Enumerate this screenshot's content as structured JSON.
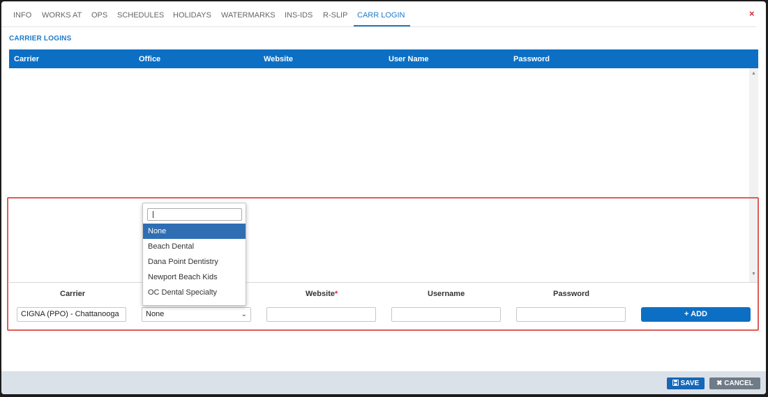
{
  "tabs": [
    {
      "label": "INFO"
    },
    {
      "label": "WORKS AT"
    },
    {
      "label": "OPS"
    },
    {
      "label": "SCHEDULES"
    },
    {
      "label": "HOLIDAYS"
    },
    {
      "label": "WATERMARKS"
    },
    {
      "label": "INS-IDS"
    },
    {
      "label": "R-SLIP"
    },
    {
      "label": "CARR LOGIN",
      "active": true
    }
  ],
  "close_label": "×",
  "section_title": "CARRIER LOGINS",
  "grid": {
    "columns": [
      "Carrier",
      "Office",
      "Website",
      "User Name",
      "Password"
    ],
    "rows": []
  },
  "add_form": {
    "labels": {
      "carrier": "Carrier",
      "website": "Website",
      "website_required": "*",
      "username": "Username",
      "password": "Password"
    },
    "carrier_value": "CIGNA (PPO) - Chattanooga",
    "office_value": "None",
    "website_value": "",
    "username_value": "",
    "password_value": "",
    "add_label": "ADD",
    "add_icon": "+"
  },
  "office_dropdown": {
    "search_value": "",
    "options": [
      "None",
      "Beach Dental",
      "Dana Point Dentistry",
      "Newport Beach Kids",
      "OC Dental Specialty"
    ],
    "selected": "None"
  },
  "footer": {
    "save_label": "SAVE",
    "save_icon": "floppy-disk-icon",
    "cancel_label": "CANCEL",
    "cancel_icon": "x-icon"
  },
  "colors": {
    "accent": "#1e7ac8",
    "header_bg": "#0c6fc4",
    "highlight_border": "#e05a5a",
    "selected_option": "#2f6eb3"
  }
}
